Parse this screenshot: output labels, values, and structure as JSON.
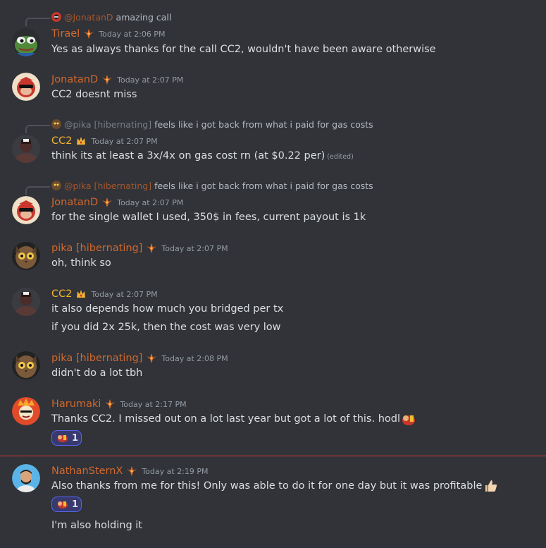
{
  "colors": {
    "background": "#313338",
    "username_orange": "#d2682d",
    "username_gold": "#f0b232",
    "text": "#dbdee1",
    "timestamp": "#949ba4",
    "new_divider": "#d83c3e",
    "reaction_bg": "#383a6e",
    "reaction_border": "#5865f2"
  },
  "messages": [
    {
      "reply": {
        "user": "@JonatanD",
        "text": "amazing call"
      },
      "user": "Tirael",
      "time": "Today at 2:06 PM",
      "lines": [
        "Yes as always thanks for the call CC2, wouldn't have been aware otherwise"
      ]
    },
    {
      "user": "JonatanD",
      "time": "Today at 2:07 PM",
      "lines": [
        "CC2 doesnt miss"
      ]
    },
    {
      "reply": {
        "user": "@pika [hibernating]",
        "text": "feels like i got back from what i paid for gas costs"
      },
      "user": "CC2",
      "time": "Today at 2:07 PM",
      "lines": [
        "think its at least a 3x/4x on gas cost rn (at $0.22 per)"
      ],
      "edited": "(edited)"
    },
    {
      "reply": {
        "user": "@pika [hibernating]",
        "text": "feels like i got back from what i paid for gas costs"
      },
      "user": "JonatanD",
      "time": "Today at 2:07 PM",
      "lines": [
        "for the single wallet I used, 350$ in fees, current payout is 1k"
      ]
    },
    {
      "user": "pika [hibernating]",
      "time": "Today at 2:07 PM",
      "lines": [
        "oh, think so"
      ]
    },
    {
      "user": "CC2",
      "time": "Today at 2:07 PM",
      "lines": [
        "it also depends how much you bridged per tx",
        "if you did 2x 25k, then the cost was very low"
      ]
    },
    {
      "user": "pika [hibernating]",
      "time": "Today at 2:08 PM",
      "lines": [
        "didn't do a lot tbh"
      ]
    },
    {
      "user": "Harumaki",
      "time": "Today at 2:17 PM",
      "lines": [
        "Thanks CC2. I missed out on a lot last year but got a lot of this. hodl"
      ],
      "reaction": {
        "emoji": "hodl-emoji",
        "count": "1"
      }
    },
    {
      "user": "NathanSternX",
      "time": "Today at 2:19 PM",
      "lines": [
        "Also thanks from me for this! Only was able to do it for one day but it was profitable",
        "I'm also holding it"
      ],
      "reaction": {
        "emoji": "hodl-emoji",
        "count": "1"
      },
      "inline_icon": "thumbs-up-icon"
    }
  ]
}
